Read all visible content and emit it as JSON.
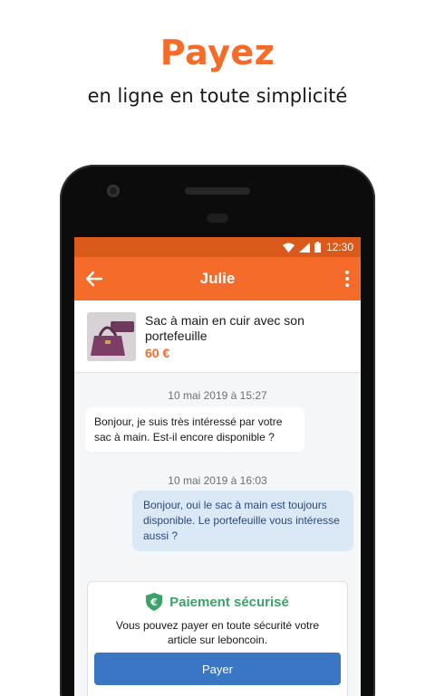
{
  "hero": {
    "title": "Payez",
    "subtitle": "en ligne en toute simplicité"
  },
  "status_bar": {
    "time": "12:30"
  },
  "app_bar": {
    "title": "Julie"
  },
  "product": {
    "title": "Sac à main en cuir avec son portefeuille",
    "price": "60 €"
  },
  "messages": [
    {
      "timestamp": "10 mai 2019 à 15:27",
      "direction": "incoming",
      "text": "Bonjour, je suis très intéressé par votre sac à main. Est-il encore disponible ?"
    },
    {
      "timestamp": "10 mai 2019 à 16:03",
      "direction": "outgoing",
      "text": "Bonjour, oui le sac à main est toujours disponible. Le portefeuille vous intéresse aussi ?"
    }
  ],
  "payment": {
    "title": "Paiement sécurisé",
    "text": "Vous pouvez payer en toute sécurité votre article sur leboncoin.",
    "button_label": "Payer",
    "icon": "euro-shield-icon"
  },
  "colors": {
    "brand_orange": "#f56b2a",
    "status_bar": "#d95a1b",
    "secure_green": "#3aa36a",
    "button_blue": "#3a76c4",
    "outgoing_bubble": "#dbe8f5"
  }
}
